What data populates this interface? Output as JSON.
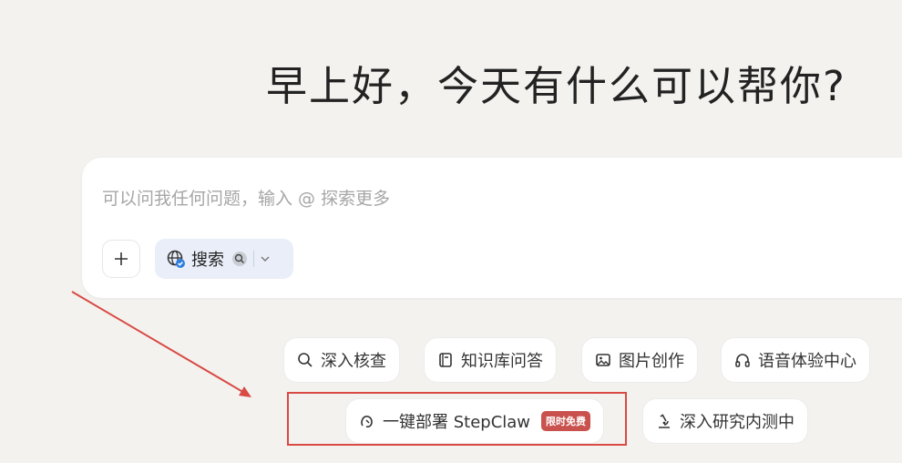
{
  "greeting": "早上好，今天有什么可以帮你?",
  "composer": {
    "placeholder": "可以问我任何问题，输入 @ 探索更多",
    "plus_icon": "plus-icon",
    "search_chip": {
      "label": "搜索",
      "icon": "globe-check-icon",
      "mini_icon": "search-engine-icon",
      "dropdown_icon": "chevron-down-icon"
    }
  },
  "suggestions": [
    {
      "label": "深入核查",
      "icon": "search-check-icon"
    },
    {
      "label": "知识库问答",
      "icon": "book-icon"
    },
    {
      "label": "图片创作",
      "icon": "image-icon"
    },
    {
      "label": "语音体验中心",
      "icon": "headphones-icon"
    },
    {
      "label": "一键部署 StepClaw",
      "icon": "claw-icon",
      "badge": "限时免费"
    },
    {
      "label": "深入研究内测中",
      "icon": "microscope-icon"
    }
  ],
  "colors": {
    "background": "#f3f2ef",
    "annotation": "#d94a44",
    "badge": "#c9524e",
    "search_chip_bg": "#e9eef8"
  }
}
